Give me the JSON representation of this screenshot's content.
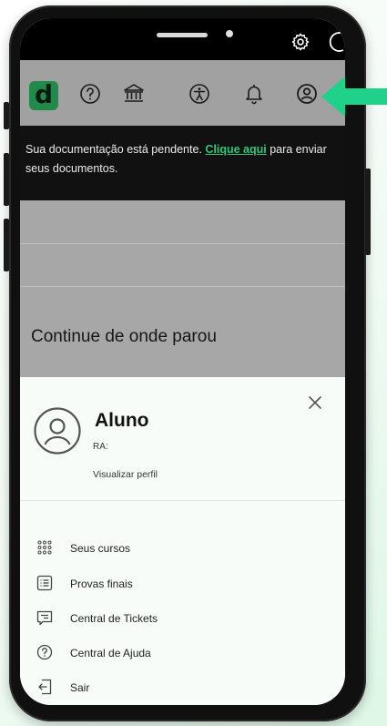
{
  "notice": {
    "text_before": "Sua documentação está pendente. ",
    "link": "Clique aqui",
    "text_after": " para enviar seus documentos."
  },
  "main": {
    "title": "Continue de onde parou"
  },
  "profile": {
    "name": "Aluno",
    "ra_label": "RA:",
    "view_profile": "Visualizar perfil"
  },
  "menu": {
    "items": [
      {
        "label": "Seus cursos",
        "icon": "grid-icon"
      },
      {
        "label": "Provas finais",
        "icon": "list-icon"
      },
      {
        "label": "Central de Tickets",
        "icon": "ticket-icon"
      },
      {
        "label": "Central de Ajuda",
        "icon": "help-icon"
      },
      {
        "label": "Sair",
        "icon": "logout-icon"
      }
    ]
  },
  "logo": {
    "letter": "d"
  },
  "colors": {
    "accent": "#22c55e",
    "brand": "#1f8a4a",
    "link": "#2ac97a",
    "arrow": "#1fd18a"
  }
}
